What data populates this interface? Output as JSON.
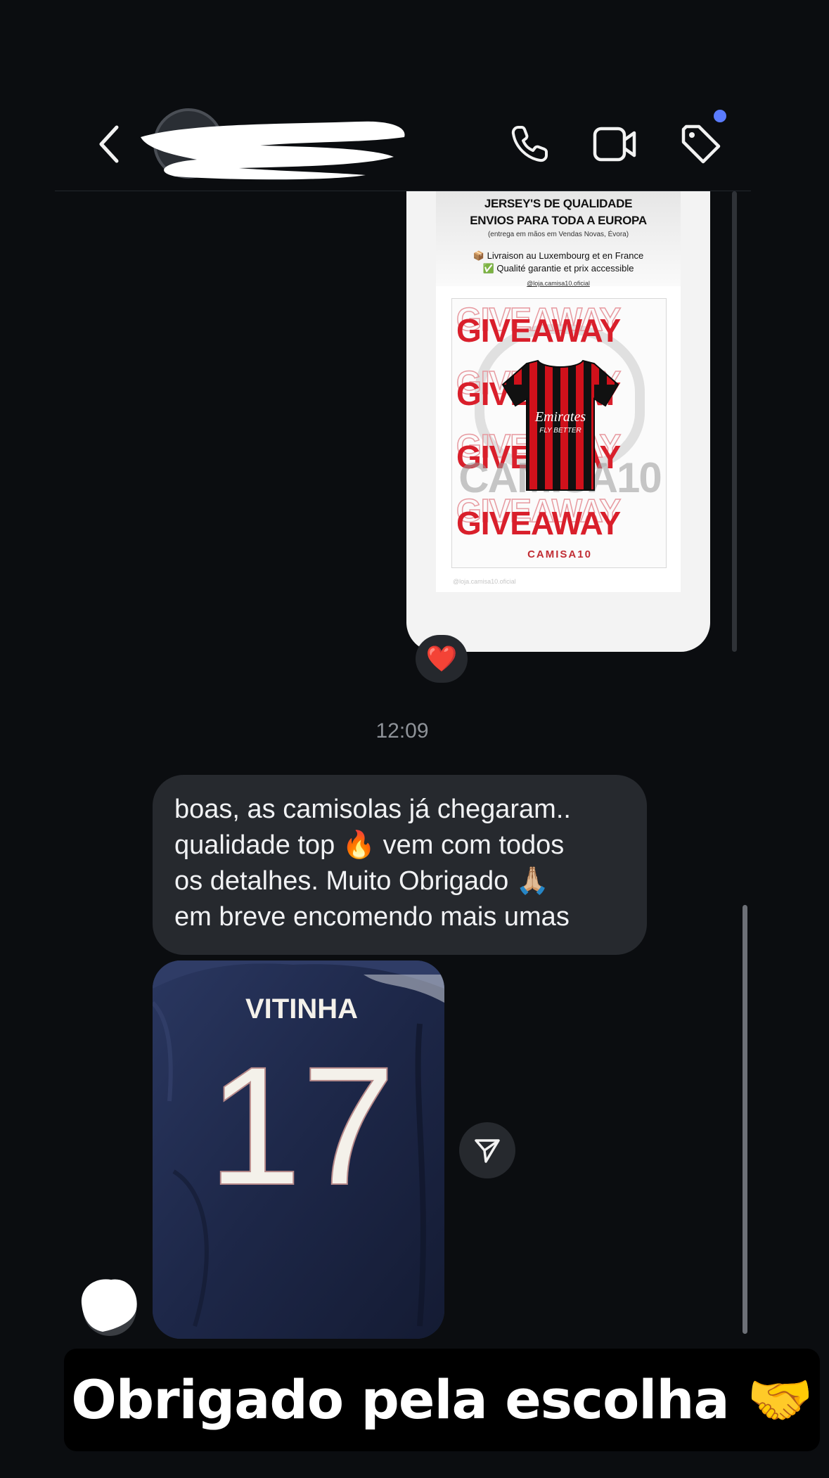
{
  "header": {
    "contact_name": "",
    "icons": [
      "chevron-left-icon",
      "phone-icon",
      "video-camera-icon",
      "tag-icon"
    ],
    "notification_dot_color": "#5b7cff"
  },
  "story": {
    "line1": "JERSEY'S DE QUALIDADE",
    "line2": "ENVIOS PARA TODA A EUROPA",
    "line3": "(entrega em mãos em Vendas Novas, Évora)",
    "line4": "📦 Livraison au Luxembourg et en France",
    "line5": "✅ Qualité garantie et prix accessible",
    "handle": "@loja.camisa10.oficial",
    "poster_word": "GIVEAWAY",
    "watermark": "CAMISA10",
    "jersey_sponsor": "Emirates",
    "jersey_tagline": "FLY BETTER",
    "brand_label": "CAMISA10",
    "footer": "@loja.camisa10.oficial",
    "reaction": "❤️"
  },
  "timestamp": "12:09",
  "message": {
    "lines": [
      "boas, as camisolas já chegaram..",
      "qualidade top 🔥  vem com todos",
      "os detalhes. Muito Obrigado 🙏🏼",
      "em breve encomendo mais umas"
    ]
  },
  "photo": {
    "player_name": "VITINHA",
    "number": "17"
  },
  "caption": "Obrigado pela escolha 🤝",
  "colors": {
    "background": "#0b0d10",
    "bubble": "#26292e",
    "giveaway_red": "#d91f2b",
    "jersey_navy": "#1f2a4a"
  }
}
